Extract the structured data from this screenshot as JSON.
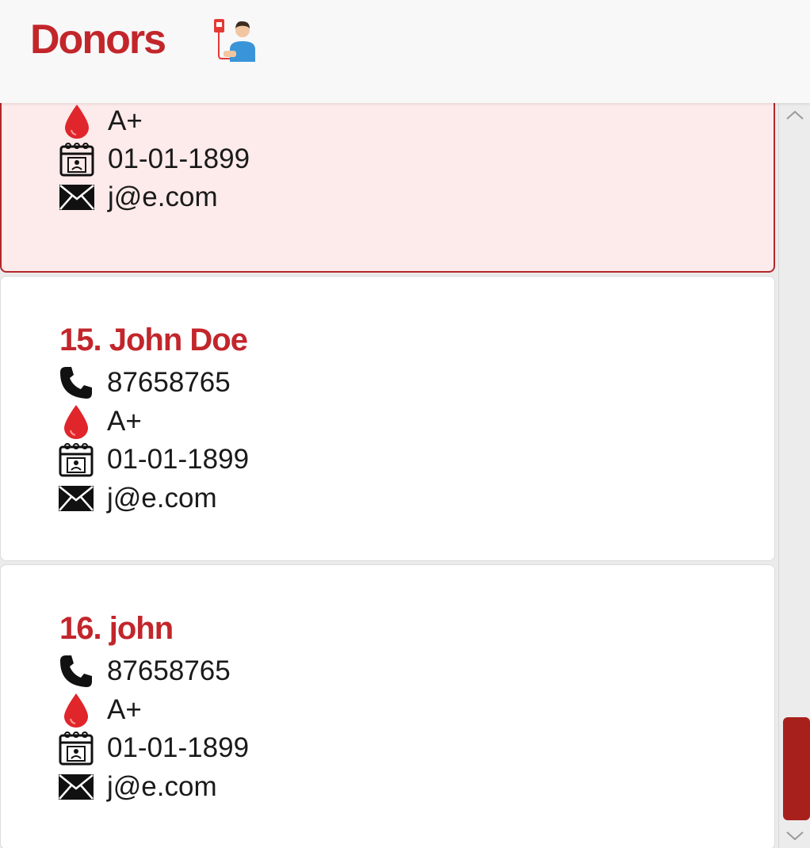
{
  "header": {
    "title": "Donors",
    "icon": "blood-donor-icon"
  },
  "colors": {
    "accent": "#c2262b",
    "selected_bg": "#fdeaea",
    "scroll_thumb": "#a8201c"
  },
  "donors": [
    {
      "name": "",
      "phone": "",
      "blood_type": "A+",
      "birth_date": "01-01-1899",
      "email": "j@e.com",
      "selected": true
    },
    {
      "name": "15. John Doe",
      "phone": "87658765",
      "blood_type": "A+",
      "birth_date": "01-01-1899",
      "email": "j@e.com",
      "selected": false
    },
    {
      "name": "16. john",
      "phone": "87658765",
      "blood_type": "A+",
      "birth_date": "01-01-1899",
      "email": "j@e.com",
      "selected": false
    }
  ],
  "icons": {
    "phone": "phone-icon",
    "blood": "blood-drop-icon",
    "birth": "calendar-icon",
    "email": "envelope-icon"
  }
}
